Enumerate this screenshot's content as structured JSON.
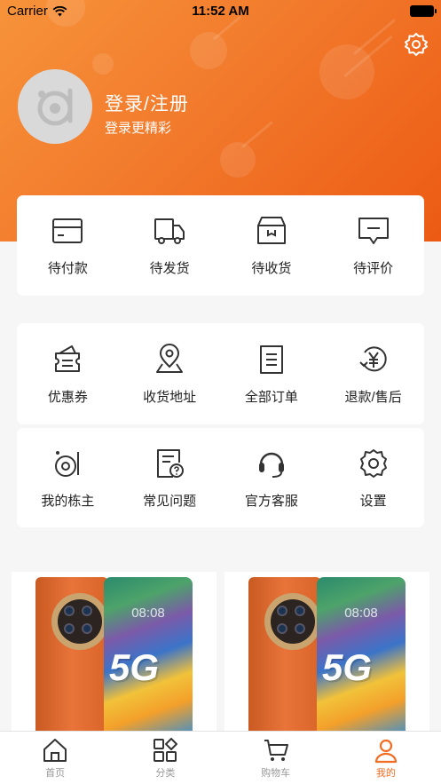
{
  "status_bar": {
    "carrier": "Carrier",
    "time": "11:52 AM"
  },
  "colors": {
    "accent": "#f26c22",
    "header_start": "#f7933a",
    "header_end": "#ec5a13"
  },
  "profile": {
    "login_title": "登录/注册",
    "login_subtitle": "登录更精彩",
    "avatar_icon": "user-avatar-d-icon",
    "settings_icon": "gear-icon"
  },
  "orders": [
    {
      "label": "待付款",
      "icon": "wallet-icon"
    },
    {
      "label": "待发货",
      "icon": "truck-icon"
    },
    {
      "label": "待收货",
      "icon": "box-icon"
    },
    {
      "label": "待评价",
      "icon": "comment-icon"
    }
  ],
  "services_row1": [
    {
      "label": "优惠券",
      "icon": "coupon-icon"
    },
    {
      "label": "收货地址",
      "icon": "location-pin-icon"
    },
    {
      "label": "全部订单",
      "icon": "order-list-icon"
    },
    {
      "label": "退款/售后",
      "icon": "refund-yen-icon"
    }
  ],
  "services_row2": [
    {
      "label": "我的栋主",
      "icon": "owner-icon"
    },
    {
      "label": "常见问题",
      "icon": "faq-icon"
    },
    {
      "label": "官方客服",
      "icon": "headset-icon"
    },
    {
      "label": "设置",
      "icon": "gear-icon"
    }
  ],
  "products": [
    {
      "screen_time": "08:08",
      "badge": "5G"
    },
    {
      "screen_time": "08:08",
      "badge": "5G"
    }
  ],
  "tabs": [
    {
      "label": "首页",
      "icon": "home-icon",
      "active": false
    },
    {
      "label": "分类",
      "icon": "category-icon",
      "active": false
    },
    {
      "label": "购物车",
      "icon": "cart-icon",
      "active": false
    },
    {
      "label": "我的",
      "icon": "user-icon",
      "active": true
    }
  ]
}
